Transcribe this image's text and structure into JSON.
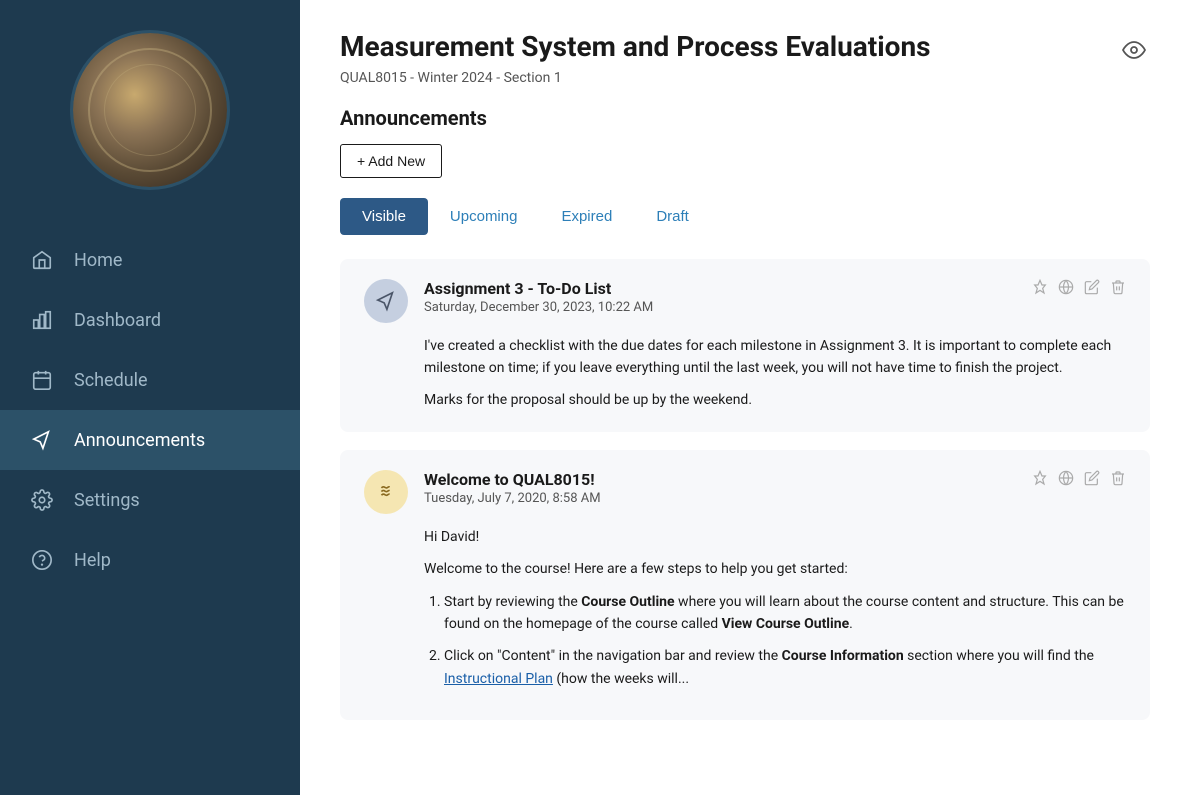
{
  "sidebar": {
    "nav_items": [
      {
        "id": "home",
        "label": "Home",
        "icon": "home-icon",
        "active": false
      },
      {
        "id": "dashboard",
        "label": "Dashboard",
        "icon": "dashboard-icon",
        "active": false
      },
      {
        "id": "schedule",
        "label": "Schedule",
        "icon": "schedule-icon",
        "active": false
      },
      {
        "id": "announcements",
        "label": "Announcements",
        "icon": "announcements-icon",
        "active": true
      },
      {
        "id": "settings",
        "label": "Settings",
        "icon": "settings-icon",
        "active": false
      },
      {
        "id": "help",
        "label": "Help",
        "icon": "help-icon",
        "active": false
      }
    ]
  },
  "header": {
    "title": "Measurement System and Process Evaluations",
    "subtitle": "QUAL8015 - Winter 2024 - Section 1",
    "eye_label": "eye"
  },
  "announcements_section": {
    "title": "Announcements",
    "add_new_label": "+ Add New"
  },
  "tabs": [
    {
      "id": "visible",
      "label": "Visible",
      "active": true
    },
    {
      "id": "upcoming",
      "label": "Upcoming",
      "active": false
    },
    {
      "id": "expired",
      "label": "Expired",
      "active": false
    },
    {
      "id": "draft",
      "label": "Draft",
      "active": false
    }
  ],
  "announcements": [
    {
      "id": "ann1",
      "avatar_type": "blue",
      "avatar_icon": "megaphone",
      "title": "Assignment 3 - To-Do List",
      "date": "Saturday, December 30, 2023, 10:22 AM",
      "body_paragraphs": [
        "I've created a checklist with the due dates for each milestone in Assignment 3. It is important to complete each milestone on time; if you leave everything until the last week, you will not have time to finish the project.",
        "Marks for the proposal should be up by the weekend."
      ],
      "body_list": []
    },
    {
      "id": "ann2",
      "avatar_type": "yellow",
      "avatar_icon": "wave",
      "title": "Welcome to QUAL8015!",
      "date": "Tuesday, July 7, 2020, 8:58 AM",
      "intro": "Hi David!",
      "intro2": "Welcome to the course!  Here are a few steps to help you get started:",
      "body_list": [
        "Start by reviewing the <b>Course Outline</b> where you will learn about the course content and structure. This can be found on the homepage of the course called <b>View Course Outline</b>.",
        "Click on \"Content\" in the navigation bar and review the <b>Course Information</b> section where you will find the <u><a>Instructional Plan</a></u> (how the weeks will..."
      ]
    }
  ]
}
